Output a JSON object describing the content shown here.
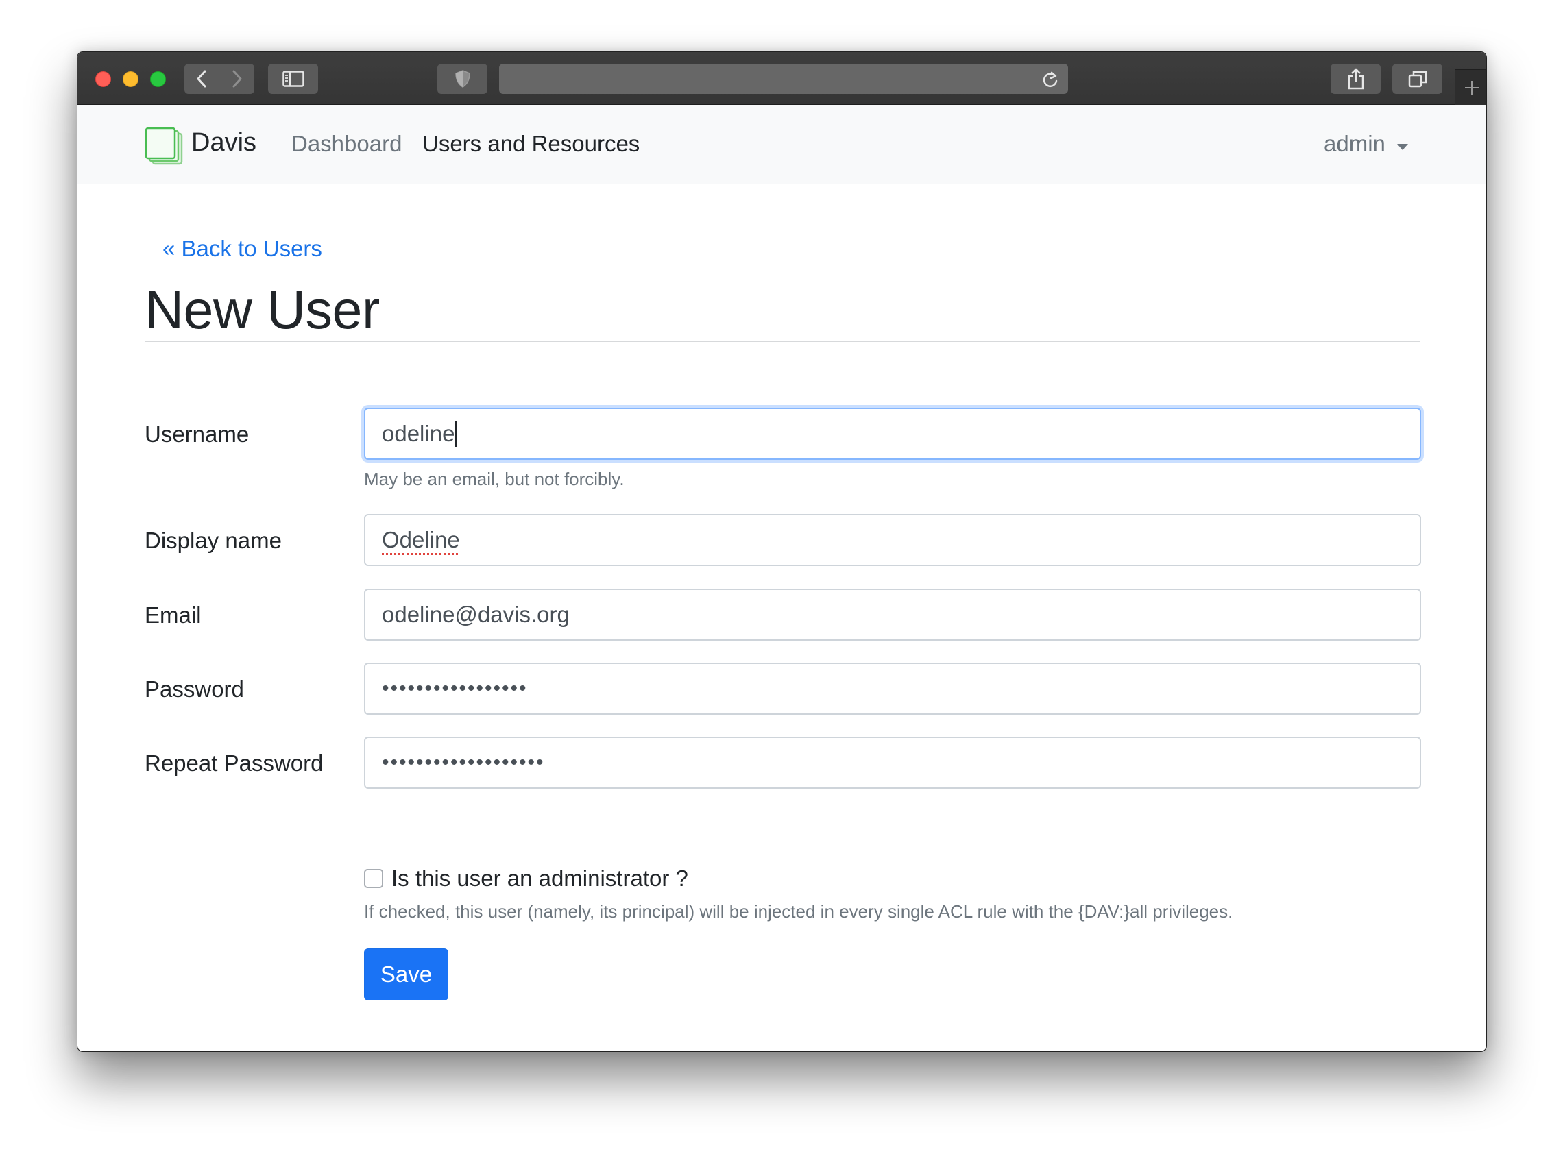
{
  "browser": {
    "icons": [
      "back-chevron-icon",
      "forward-chevron-icon",
      "sidebar-icon",
      "shield-icon",
      "reload-icon",
      "share-icon",
      "tabs-icon",
      "plus-icon"
    ]
  },
  "navbar": {
    "brand": "Davis",
    "links": [
      {
        "label": "Dashboard",
        "active": false
      },
      {
        "label": "Users and Resources",
        "active": true
      }
    ],
    "user_menu": "admin"
  },
  "page": {
    "back_link": "« Back to Users",
    "title": "New User"
  },
  "form": {
    "username": {
      "label": "Username",
      "value": "odeline",
      "help": "May be an email, but not forcibly."
    },
    "display_name": {
      "label": "Display name",
      "value": "Odeline"
    },
    "email": {
      "label": "Email",
      "value": "odeline@davis.org"
    },
    "password": {
      "label": "Password",
      "masked": "•••••••••••••••••"
    },
    "repeat_password": {
      "label": "Repeat Password",
      "masked": "•••••••••••••••••••"
    },
    "admin": {
      "label": "Is this user an administrator ?",
      "checked": false,
      "help": "If checked, this user (namely, its principal) will be injected in every single ACL rule with the {DAV:}all privileges."
    },
    "save_label": "Save"
  },
  "colors": {
    "accent": "#1a73f5",
    "link": "#1a73e8",
    "navbar_bg": "#f8f9fa",
    "titlebar_bg": "#3a3a3a"
  }
}
